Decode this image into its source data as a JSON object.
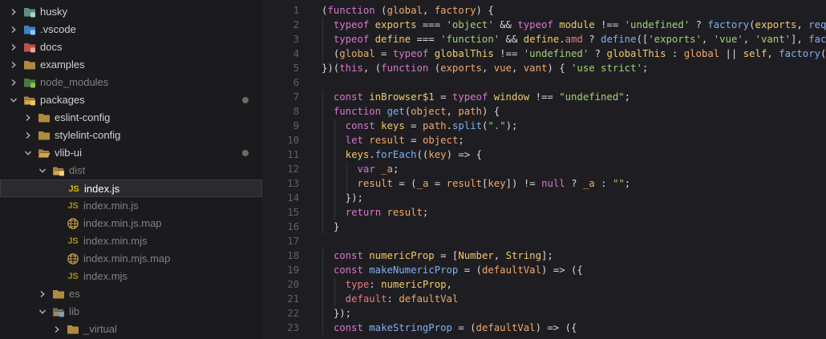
{
  "colors": {
    "sidebar_bg": "#1b1b1e",
    "editor_bg": "#1e1e22",
    "selected_row": "#2a2b2f",
    "modified_dot": "#6e6a5c",
    "folder": "#d8a54a",
    "js_badge": "#d7b400"
  },
  "explorer": {
    "items": [
      {
        "label": "husky",
        "depth": 0,
        "kind": "folder",
        "icon": "husky-folder-icon",
        "state": "collapsed",
        "dim": false
      },
      {
        "label": ".vscode",
        "depth": 0,
        "kind": "folder",
        "icon": "vscode-folder-icon",
        "state": "collapsed",
        "dim": false
      },
      {
        "label": "docs",
        "depth": 0,
        "kind": "folder",
        "icon": "docs-folder-icon",
        "state": "collapsed",
        "dim": false
      },
      {
        "label": "examples",
        "depth": 0,
        "kind": "folder",
        "icon": "folder-icon",
        "state": "collapsed",
        "dim": false
      },
      {
        "label": "node_modules",
        "depth": 0,
        "kind": "folder",
        "icon": "node-modules-folder-icon",
        "state": "collapsed",
        "dim": true
      },
      {
        "label": "packages",
        "depth": 0,
        "kind": "folder",
        "icon": "packages-folder-open-icon",
        "state": "expanded",
        "dim": false,
        "modified": true
      },
      {
        "label": "eslint-config",
        "depth": 1,
        "kind": "folder",
        "icon": "folder-icon",
        "state": "collapsed",
        "dim": false
      },
      {
        "label": "stylelint-config",
        "depth": 1,
        "kind": "folder",
        "icon": "folder-icon",
        "state": "collapsed",
        "dim": false
      },
      {
        "label": "vlib-ui",
        "depth": 1,
        "kind": "folder",
        "icon": "folder-open-icon",
        "state": "expanded",
        "dim": false,
        "modified": true
      },
      {
        "label": "dist",
        "depth": 2,
        "kind": "folder",
        "icon": "dist-folder-open-icon",
        "state": "expanded",
        "dim": true
      },
      {
        "label": "index.js",
        "depth": 3,
        "kind": "file",
        "icon": "javascript-file-icon",
        "dim": false,
        "selected": true
      },
      {
        "label": "index.min.js",
        "depth": 3,
        "kind": "file",
        "icon": "javascript-file-icon",
        "dim": true
      },
      {
        "label": "index.min.js.map",
        "depth": 3,
        "kind": "file",
        "icon": "sourcemap-file-icon",
        "dim": true
      },
      {
        "label": "index.min.mjs",
        "depth": 3,
        "kind": "file",
        "icon": "javascript-file-icon",
        "dim": true
      },
      {
        "label": "index.min.mjs.map",
        "depth": 3,
        "kind": "file",
        "icon": "sourcemap-file-icon",
        "dim": true
      },
      {
        "label": "index.mjs",
        "depth": 3,
        "kind": "file",
        "icon": "javascript-file-icon",
        "dim": true
      },
      {
        "label": "es",
        "depth": 2,
        "kind": "folder",
        "icon": "folder-icon",
        "state": "collapsed",
        "dim": true
      },
      {
        "label": "lib",
        "depth": 2,
        "kind": "folder",
        "icon": "lib-folder-open-icon",
        "state": "expanded",
        "dim": true
      },
      {
        "label": "_virtual",
        "depth": 3,
        "kind": "folder",
        "icon": "folder-icon",
        "state": "collapsed",
        "dim": true
      }
    ],
    "js_badge_text": "JS"
  },
  "editor": {
    "lines": [
      {
        "n": "1",
        "indent": 0,
        "tokens": [
          [
            "p",
            "("
          ],
          [
            "k",
            "function"
          ],
          [
            "p",
            " ("
          ],
          [
            "v",
            "global"
          ],
          [
            "p",
            ", "
          ],
          [
            "v",
            "factory"
          ],
          [
            "p",
            ") {"
          ]
        ]
      },
      {
        "n": "2",
        "indent": 1,
        "tokens": [
          [
            "k",
            "typeof"
          ],
          [
            "p",
            " "
          ],
          [
            "b",
            "exports"
          ],
          [
            "p",
            " === "
          ],
          [
            "s",
            "'object'"
          ],
          [
            "p",
            " && "
          ],
          [
            "k",
            "typeof"
          ],
          [
            "p",
            " "
          ],
          [
            "b",
            "module"
          ],
          [
            "p",
            " !== "
          ],
          [
            "s",
            "'undefined'"
          ],
          [
            "p",
            " ? "
          ],
          [
            "f",
            "factory"
          ],
          [
            "p",
            "("
          ],
          [
            "b",
            "exports"
          ],
          [
            "p",
            ", "
          ],
          [
            "f",
            "requi"
          ]
        ]
      },
      {
        "n": "3",
        "indent": 1,
        "tokens": [
          [
            "k",
            "typeof"
          ],
          [
            "p",
            " "
          ],
          [
            "b",
            "define"
          ],
          [
            "p",
            " === "
          ],
          [
            "s",
            "'function'"
          ],
          [
            "p",
            " && "
          ],
          [
            "b",
            "define"
          ],
          [
            "p",
            "."
          ],
          [
            "a",
            "amd"
          ],
          [
            "p",
            " ? "
          ],
          [
            "f",
            "define"
          ],
          [
            "p",
            "(["
          ],
          [
            "s",
            "'exports'"
          ],
          [
            "p",
            ", "
          ],
          [
            "s",
            "'vue'"
          ],
          [
            "p",
            ", "
          ],
          [
            "s",
            "'vant'"
          ],
          [
            "p",
            "], "
          ],
          [
            "f",
            "facto"
          ]
        ]
      },
      {
        "n": "4",
        "indent": 1,
        "tokens": [
          [
            "p",
            "("
          ],
          [
            "v",
            "global"
          ],
          [
            "p",
            " = "
          ],
          [
            "k",
            "typeof"
          ],
          [
            "p",
            " "
          ],
          [
            "b",
            "globalThis"
          ],
          [
            "p",
            " !== "
          ],
          [
            "s",
            "'undefined'"
          ],
          [
            "p",
            " ? "
          ],
          [
            "b",
            "globalThis"
          ],
          [
            "p",
            " : "
          ],
          [
            "v",
            "global"
          ],
          [
            "p",
            " || "
          ],
          [
            "b",
            "self"
          ],
          [
            "p",
            ", "
          ],
          [
            "f",
            "factory"
          ],
          [
            "p",
            "(gl"
          ]
        ]
      },
      {
        "n": "5",
        "indent": 0,
        "tokens": [
          [
            "p",
            "})("
          ],
          [
            "k",
            "this"
          ],
          [
            "p",
            ", ("
          ],
          [
            "k",
            "function"
          ],
          [
            "p",
            " ("
          ],
          [
            "v",
            "exports"
          ],
          [
            "p",
            ", "
          ],
          [
            "v",
            "vue"
          ],
          [
            "p",
            ", "
          ],
          [
            "v",
            "vant"
          ],
          [
            "p",
            ") { "
          ],
          [
            "s",
            "'use strict'"
          ],
          [
            "p",
            ";"
          ]
        ]
      },
      {
        "n": "6",
        "indent": 0,
        "tokens": []
      },
      {
        "n": "7",
        "indent": 1,
        "tokens": [
          [
            "k",
            "const"
          ],
          [
            "p",
            " "
          ],
          [
            "b",
            "inBrowser$1"
          ],
          [
            "p",
            " = "
          ],
          [
            "k",
            "typeof"
          ],
          [
            "p",
            " "
          ],
          [
            "b",
            "window"
          ],
          [
            "p",
            " !== "
          ],
          [
            "s",
            "\"undefined\""
          ],
          [
            "p",
            ";"
          ]
        ]
      },
      {
        "n": "8",
        "indent": 1,
        "tokens": [
          [
            "k",
            "function"
          ],
          [
            "p",
            " "
          ],
          [
            "f",
            "get"
          ],
          [
            "p",
            "("
          ],
          [
            "v",
            "object"
          ],
          [
            "p",
            ", "
          ],
          [
            "v",
            "path"
          ],
          [
            "p",
            ") {"
          ]
        ]
      },
      {
        "n": "9",
        "indent": 2,
        "tokens": [
          [
            "k",
            "const"
          ],
          [
            "p",
            " "
          ],
          [
            "b",
            "keys"
          ],
          [
            "p",
            " = "
          ],
          [
            "v",
            "path"
          ],
          [
            "p",
            "."
          ],
          [
            "f",
            "split"
          ],
          [
            "p",
            "("
          ],
          [
            "s",
            "\".\""
          ],
          [
            "p",
            ");"
          ]
        ]
      },
      {
        "n": "10",
        "indent": 2,
        "tokens": [
          [
            "k",
            "let"
          ],
          [
            "p",
            " "
          ],
          [
            "v",
            "result"
          ],
          [
            "p",
            " = "
          ],
          [
            "v",
            "object"
          ],
          [
            "p",
            ";"
          ]
        ]
      },
      {
        "n": "11",
        "indent": 2,
        "tokens": [
          [
            "b",
            "keys"
          ],
          [
            "p",
            "."
          ],
          [
            "f",
            "forEach"
          ],
          [
            "p",
            "(("
          ],
          [
            "v",
            "key"
          ],
          [
            "p",
            ") => {"
          ]
        ]
      },
      {
        "n": "12",
        "indent": 3,
        "tokens": [
          [
            "k",
            "var"
          ],
          [
            "p",
            " "
          ],
          [
            "v",
            "_a"
          ],
          [
            "p",
            ";"
          ]
        ]
      },
      {
        "n": "13",
        "indent": 3,
        "tokens": [
          [
            "v",
            "result"
          ],
          [
            "p",
            " = ("
          ],
          [
            "v",
            "_a"
          ],
          [
            "p",
            " = "
          ],
          [
            "v",
            "result"
          ],
          [
            "p",
            "["
          ],
          [
            "v",
            "key"
          ],
          [
            "p",
            "]) != "
          ],
          [
            "k",
            "null"
          ],
          [
            "p",
            " ? "
          ],
          [
            "v",
            "_a"
          ],
          [
            "p",
            " : "
          ],
          [
            "s",
            "\"\""
          ],
          [
            "p",
            ";"
          ]
        ]
      },
      {
        "n": "14",
        "indent": 2,
        "tokens": [
          [
            "p",
            "});"
          ]
        ]
      },
      {
        "n": "15",
        "indent": 2,
        "tokens": [
          [
            "k",
            "return"
          ],
          [
            "p",
            " "
          ],
          [
            "v",
            "result"
          ],
          [
            "p",
            ";"
          ]
        ]
      },
      {
        "n": "16",
        "indent": 1,
        "tokens": [
          [
            "p",
            "}"
          ]
        ]
      },
      {
        "n": "17",
        "indent": 0,
        "tokens": []
      },
      {
        "n": "18",
        "indent": 1,
        "tokens": [
          [
            "k",
            "const"
          ],
          [
            "p",
            " "
          ],
          [
            "b",
            "numericProp"
          ],
          [
            "p",
            " = ["
          ],
          [
            "b",
            "Number"
          ],
          [
            "p",
            ", "
          ],
          [
            "b",
            "String"
          ],
          [
            "p",
            "];"
          ]
        ]
      },
      {
        "n": "19",
        "indent": 1,
        "tokens": [
          [
            "k",
            "const"
          ],
          [
            "p",
            " "
          ],
          [
            "f",
            "makeNumericProp"
          ],
          [
            "p",
            " = ("
          ],
          [
            "v",
            "defaultVal"
          ],
          [
            "p",
            ") => ({"
          ]
        ]
      },
      {
        "n": "20",
        "indent": 2,
        "tokens": [
          [
            "a",
            "type"
          ],
          [
            "p",
            ": "
          ],
          [
            "b",
            "numericProp"
          ],
          [
            "p",
            ","
          ]
        ]
      },
      {
        "n": "21",
        "indent": 2,
        "tokens": [
          [
            "a",
            "default"
          ],
          [
            "p",
            ": "
          ],
          [
            "v",
            "defaultVal"
          ]
        ]
      },
      {
        "n": "22",
        "indent": 1,
        "tokens": [
          [
            "p",
            "});"
          ]
        ]
      },
      {
        "n": "23",
        "indent": 1,
        "tokens": [
          [
            "k",
            "const"
          ],
          [
            "p",
            " "
          ],
          [
            "f",
            "makeStringProp"
          ],
          [
            "p",
            " = ("
          ],
          [
            "v",
            "defaultVal"
          ],
          [
            "p",
            ") => ({"
          ]
        ]
      }
    ]
  }
}
